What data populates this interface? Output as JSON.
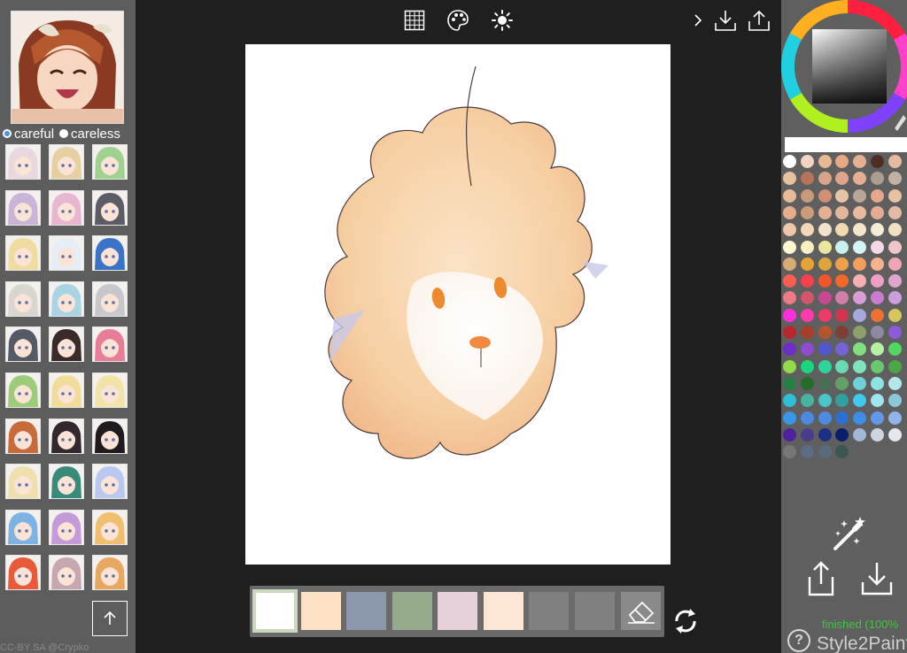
{
  "left_panel": {
    "modes": [
      {
        "label": "careful",
        "selected": true
      },
      {
        "label": "careless",
        "selected": false
      }
    ],
    "reference_count": 30,
    "upload_icon": "upload-arrow-icon",
    "credit": "CC-BY SA @Crypko"
  },
  "toolbar": {
    "center_icons": [
      "grid-icon",
      "palette-icon",
      "brightness-icon"
    ],
    "right_icons": [
      "chevron-right-icon",
      "download-icon",
      "share-icon"
    ]
  },
  "color_hints": {
    "swatches": [
      "#ffffff",
      "#fde1c4",
      "#8b97ad",
      "#95ab8b",
      "#e5cfd9",
      "#fde6d6",
      "#808080",
      "#808080"
    ],
    "selected_index": 0,
    "eraser_icon": "eraser-icon",
    "refresh_icon": "refresh-icon"
  },
  "right_panel": {
    "palette": [
      "#ffffff",
      "#f1d4c1",
      "#e8b794",
      "#e5a883",
      "#e6b193",
      "#4e2e22",
      "#e8b9a1",
      "#e6c2a0",
      "#b8745a",
      "#d7a38a",
      "#e0a48a",
      "#e6ae93",
      "#ad9d90",
      "#c3b1a3",
      "#e6ba97",
      "#c79a7a",
      "#d18e73",
      "#e6c4a6",
      "#b9a696",
      "#e6a78b",
      "#e8c1a1",
      "#e6ad8b",
      "#cc9b78",
      "#e6b095",
      "#e2b69a",
      "#ebb9a1",
      "#e7ab93",
      "#e4b9a6",
      "#f0c7a8",
      "#f2d7b9",
      "#f2e3cc",
      "#f1dab2",
      "#f3e6ca",
      "#f4edd6",
      "#f1e1c4",
      "#fff7d0",
      "#f6f0c2",
      "#e9e69d",
      "#c9f2ee",
      "#d5f4f5",
      "#f6d9e8",
      "#f0c6ca",
      "#d7ac74",
      "#e6a236",
      "#dfa33c",
      "#eda149",
      "#f29f5d",
      "#f6b28c",
      "#f0a5b6",
      "#f95e50",
      "#f4414d",
      "#f2552b",
      "#f56728",
      "#f6b0b4",
      "#ef9fc4",
      "#dfa7cf",
      "#ec7b85",
      "#d2576a",
      "#c94891",
      "#d17ea8",
      "#d99cd4",
      "#cc7ad2",
      "#cb9edc",
      "#ff2fdc",
      "#ff3aab",
      "#ec3b69",
      "#d13550",
      "#a8a8e0",
      "#ef7033",
      "#d8c55c",
      "#b8262e",
      "#a63f2b",
      "#b6542d",
      "#7f3e34",
      "#8f9f6c",
      "#8e89a1",
      "#8e59da",
      "#6d2ec8",
      "#8f4cd0",
      "#5256cf",
      "#7663da",
      "#82e080",
      "#b7f0a5",
      "#51d760",
      "#91db4a",
      "#1ad77d",
      "#2dd39c",
      "#68dbb2",
      "#81e5bb",
      "#67c86d",
      "#4da645",
      "#277f45",
      "#246d28",
      "#4a6e54",
      "#65a066",
      "#6fd2d8",
      "#8ce4e1",
      "#b3e7ea",
      "#2dbfd5",
      "#4ab39f",
      "#4ac4c8",
      "#30a0a0",
      "#40c8f0",
      "#9ee5ee",
      "#8cc9db",
      "#3a96e8",
      "#4c89e3",
      "#4e8ae2",
      "#2e6fd4",
      "#3e8de8",
      "#6198ea",
      "#91b5ea",
      "#50219c",
      "#4a3d8e",
      "#1b2f85",
      "#0a1f6c",
      "#a3b6d7",
      "#cdd5e1",
      "#e4e8ee",
      "#777777",
      "#5b6d84",
      "#59697e",
      "#3a564e"
    ],
    "magic_icon": "magic-wand-icon",
    "share_icon": "share-icon",
    "download_icon": "download-icon",
    "status": "finished (100%",
    "help_icon": "help-icon",
    "help_glyph": "?",
    "brand": "Style2Paint"
  }
}
